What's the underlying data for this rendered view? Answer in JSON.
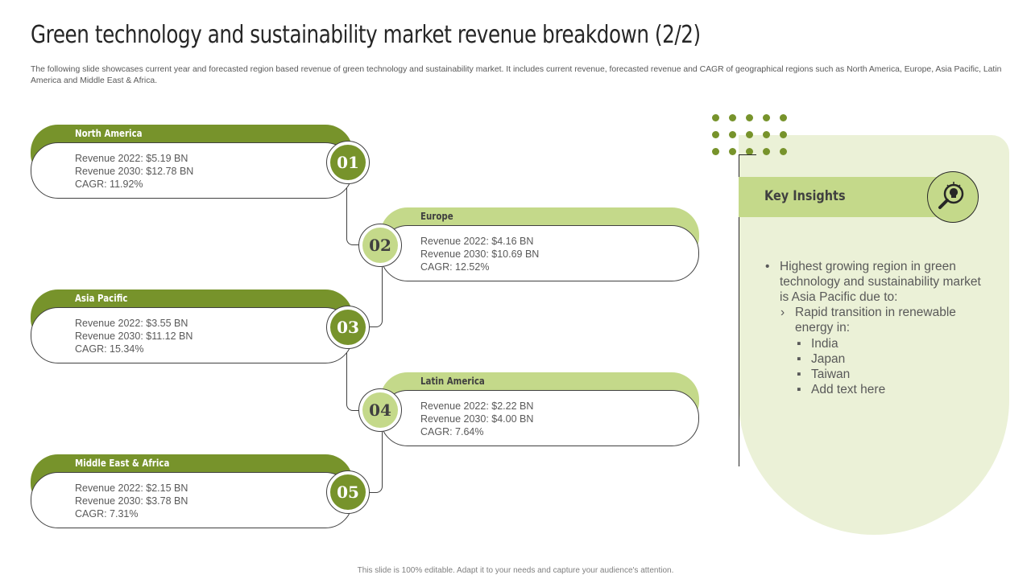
{
  "title": "Green technology and sustainability market revenue breakdown (2/2)",
  "subtitle": "The following slide showcases current year and forecasted region based revenue of green technology and sustainability market. It includes current revenue, forecasted revenue and CAGR of geographical regions such as North America, Europe, Asia Pacific, Latin America and Middle East & Africa.",
  "regions": [
    {
      "num": "01",
      "name": "North America",
      "rev2022": "Revenue  2022: $5.19 BN",
      "rev2030": "Revenue  2030: $12.78 BN",
      "cagr": "CAGR: 11.92%"
    },
    {
      "num": "02",
      "name": "Europe",
      "rev2022": "Revenue  2022: $4.16 BN",
      "rev2030": "Revenue  2030: $10.69 BN",
      "cagr": "CAGR: 12.52%"
    },
    {
      "num": "03",
      "name": "Asia Pacific",
      "rev2022": "Revenue  2022: $3.55 BN",
      "rev2030": "Revenue  2030: $11.12 BN",
      "cagr": "CAGR: 15.34%"
    },
    {
      "num": "04",
      "name": "Latin America",
      "rev2022": "Revenue  2022: $2.22 BN",
      "rev2030": "Revenue  2030: $4.00 BN",
      "cagr": "CAGR: 7.64%"
    },
    {
      "num": "05",
      "name": "Middle East & Africa",
      "rev2022": "Revenue  2022: $2.15 BN",
      "rev2030": "Revenue  2030: $3.78 BN",
      "cagr": "CAGR: 7.31%"
    }
  ],
  "insights": {
    "title": "Key Insights",
    "icon": "lightbulb-magnifier-icon",
    "bullet": "Highest growing region in green technology and sustainability market is Asia Pacific due to:",
    "sub": "Rapid transition in renewable energy in:",
    "items": [
      "India",
      "Japan",
      "Taiwan",
      "Add text here"
    ]
  },
  "footer": "This slide is 100% editable. Adapt it to your needs and capture your audience's attention.",
  "colors": {
    "dark_green": "#77932b",
    "light_green": "#c4d98a",
    "panel": "#ebf1d7"
  }
}
